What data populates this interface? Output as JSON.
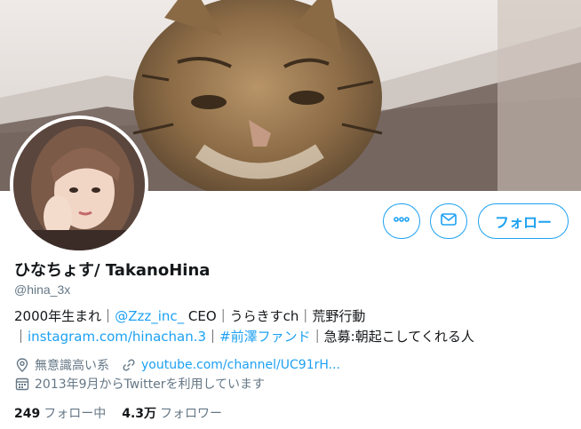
{
  "profile": {
    "display_name": "ひなちょす/ TakanoHina",
    "handle": "@hina_3x",
    "bio": {
      "line1_a": "2000年生まれ｜",
      "line1_mention": "@Zzz_inc_",
      "line1_b": " CEO｜うらきすch｜荒野行動",
      "line2_a": "｜",
      "line2_link": "instagram.com/hinachan.3",
      "line2_b": "｜",
      "line2_hashtag": "#前澤ファンド",
      "line2_c": "｜急募:朝起こしてくれる人"
    },
    "location": "無意識高い系",
    "url": "youtube.com/channel/UC91rH...",
    "joined": "2013年9月からTwitterを利用しています",
    "following_count": "249",
    "following_label": "フォロー中",
    "followers_count": "4.3万",
    "followers_label": "フォロワー"
  },
  "actions": {
    "follow_label": "フォロー"
  },
  "icons": {
    "more": "more-icon",
    "message": "envelope-icon",
    "location": "location-pin-icon",
    "link": "link-icon",
    "calendar": "calendar-icon"
  },
  "colors": {
    "accent": "#1da1f2",
    "text": "#14171a",
    "muted": "#657786"
  }
}
